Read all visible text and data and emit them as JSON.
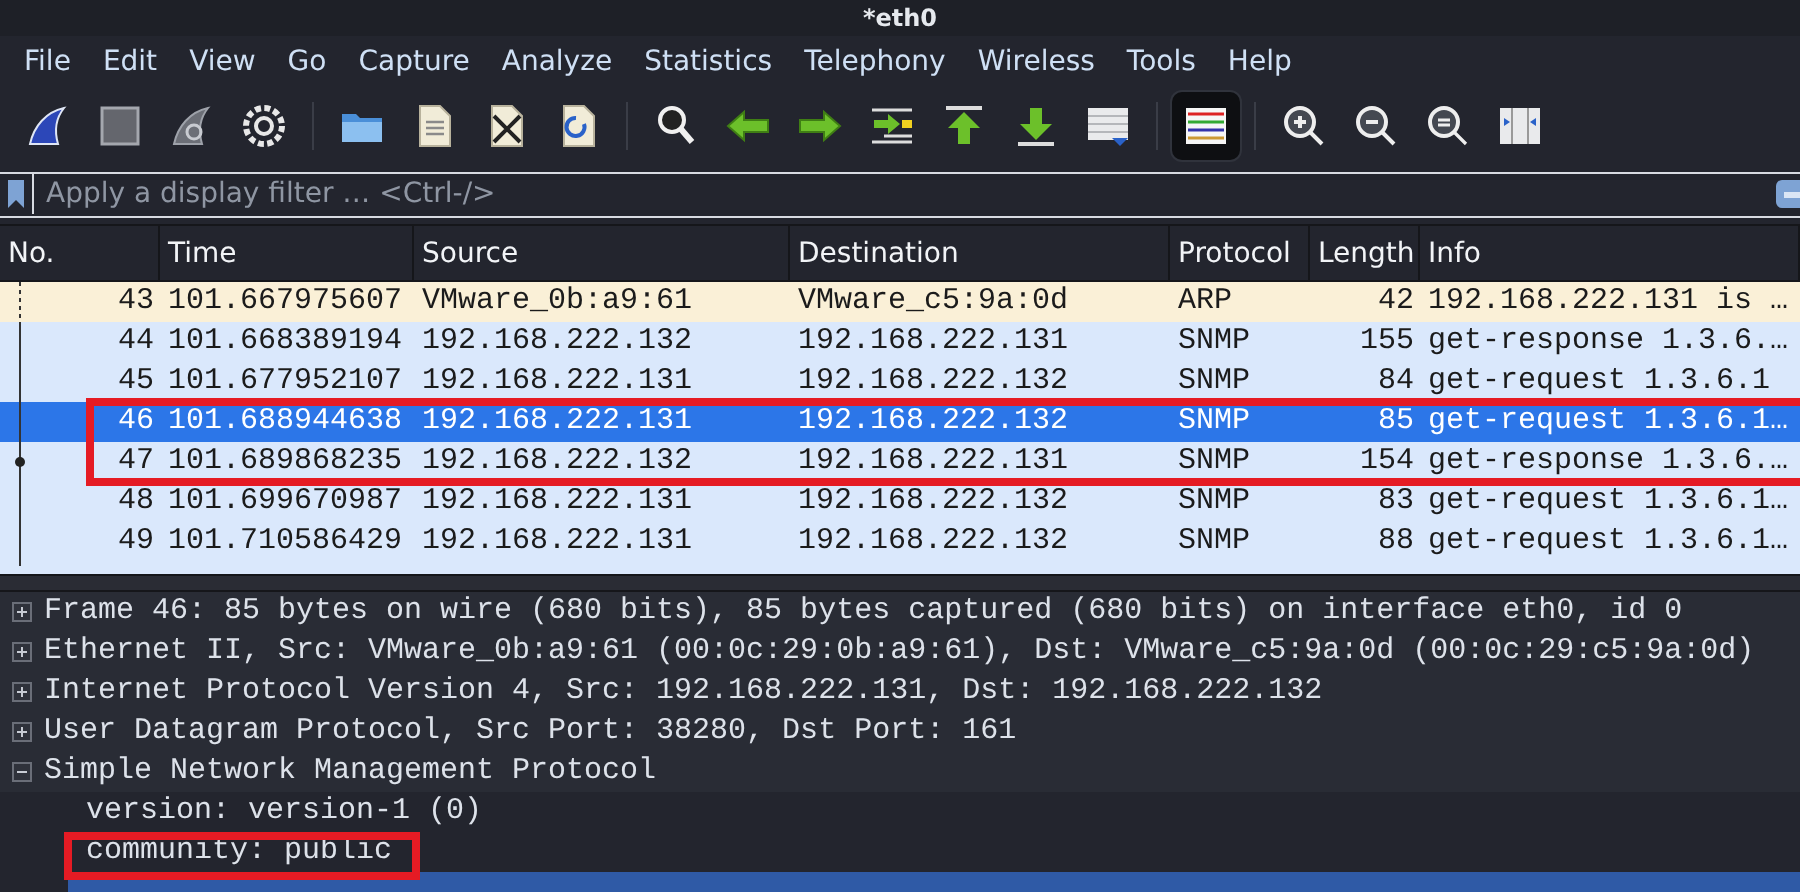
{
  "window": {
    "title": "*eth0"
  },
  "menu": [
    "File",
    "Edit",
    "View",
    "Go",
    "Capture",
    "Analyze",
    "Statistics",
    "Telephony",
    "Wireless",
    "Tools",
    "Help"
  ],
  "toolbar": [
    [
      {
        "kind": "fin",
        "on": false
      },
      {
        "kind": "stop",
        "on": false
      },
      {
        "kind": "restart",
        "on": false
      },
      {
        "kind": "options",
        "on": false
      }
    ],
    [
      {
        "kind": "open",
        "on": false
      },
      {
        "kind": "file",
        "on": false
      },
      {
        "kind": "close",
        "on": false
      },
      {
        "kind": "reload",
        "on": false
      }
    ],
    [
      {
        "kind": "find",
        "on": false
      },
      {
        "kind": "back",
        "on": false
      },
      {
        "kind": "forward",
        "on": false
      },
      {
        "kind": "goto",
        "on": false
      },
      {
        "kind": "first",
        "on": false
      },
      {
        "kind": "last",
        "on": false
      },
      {
        "kind": "autoscroll",
        "on": false
      }
    ],
    [
      {
        "kind": "colorize",
        "on": true
      }
    ],
    [
      {
        "kind": "zoomin",
        "on": false
      },
      {
        "kind": "zoomout",
        "on": false
      },
      {
        "kind": "zoomreset",
        "on": false
      },
      {
        "kind": "resize",
        "on": false
      }
    ]
  ],
  "filter": {
    "placeholder": "Apply a display filter … <Ctrl-/>"
  },
  "packet_list": {
    "columns": [
      "No.",
      "Time",
      "Source",
      "Destination",
      "Protocol",
      "Length",
      "Info"
    ],
    "rows": [
      {
        "no": "43",
        "time": "101.667975607",
        "source": "VMware_0b:a9:61",
        "destination": "VMware_c5:9a:0d",
        "protocol": "ARP",
        "length": "42",
        "info": "192.168.222.131 is …",
        "color": "#faf0d7",
        "selected": false,
        "highlighted": false
      },
      {
        "no": "44",
        "time": "101.668389194",
        "source": "192.168.222.132",
        "destination": "192.168.222.131",
        "protocol": "SNMP",
        "length": "155",
        "info": "get-response 1.3.6.…",
        "color": "#dae8fc",
        "selected": false,
        "highlighted": false
      },
      {
        "no": "45",
        "time": "101.677952107",
        "source": "192.168.222.131",
        "destination": "192.168.222.132",
        "protocol": "SNMP",
        "length": "84",
        "info": "get-request 1.3.6.1",
        "color": "#dae8fc",
        "selected": false,
        "highlighted": false
      },
      {
        "no": "46",
        "time": "101.688944638",
        "source": "192.168.222.131",
        "destination": "192.168.222.132",
        "protocol": "SNMP",
        "length": "85",
        "info": "get-request 1.3.6.1…",
        "selected": true,
        "highlighted": true
      },
      {
        "no": "47",
        "time": "101.689868235",
        "source": "192.168.222.132",
        "destination": "192.168.222.131",
        "protocol": "SNMP",
        "length": "154",
        "info": "get-response 1.3.6.…",
        "color": "#dae8fc",
        "selected": false,
        "highlighted": true
      },
      {
        "no": "48",
        "time": "101.699670987",
        "source": "192.168.222.131",
        "destination": "192.168.222.132",
        "protocol": "SNMP",
        "length": "83",
        "info": "get-request 1.3.6.1…",
        "color": "#dae8fc",
        "selected": false,
        "highlighted": false
      },
      {
        "no": "49",
        "time": "101.710586429",
        "source": "192.168.222.131",
        "destination": "192.168.222.132",
        "protocol": "SNMP",
        "length": "88",
        "info": "get-request 1.3.6.1…",
        "color": "#dae8fc",
        "selected": false,
        "highlighted": false
      }
    ]
  },
  "details": [
    {
      "text": "Frame 46: 85 bytes on wire (680 bits), 85 bytes captured (680 bits) on interface eth0, id 0",
      "expanded": false
    },
    {
      "text": "Ethernet II, Src: VMware_0b:a9:61 (00:0c:29:0b:a9:61), Dst: VMware_c5:9a:0d (00:0c:29:c5:9a:0d)",
      "expanded": false
    },
    {
      "text": "Internet Protocol Version 4, Src: 192.168.222.131, Dst: 192.168.222.132",
      "expanded": false
    },
    {
      "text": "User Datagram Protocol, Src Port: 38280, Dst Port: 161",
      "expanded": false
    },
    {
      "text": "Simple Network Management Protocol",
      "expanded": true,
      "children": [
        {
          "text": "version: version-1 (0)",
          "highlighted": false
        },
        {
          "text": "community: public",
          "highlighted": true
        }
      ]
    }
  ]
}
